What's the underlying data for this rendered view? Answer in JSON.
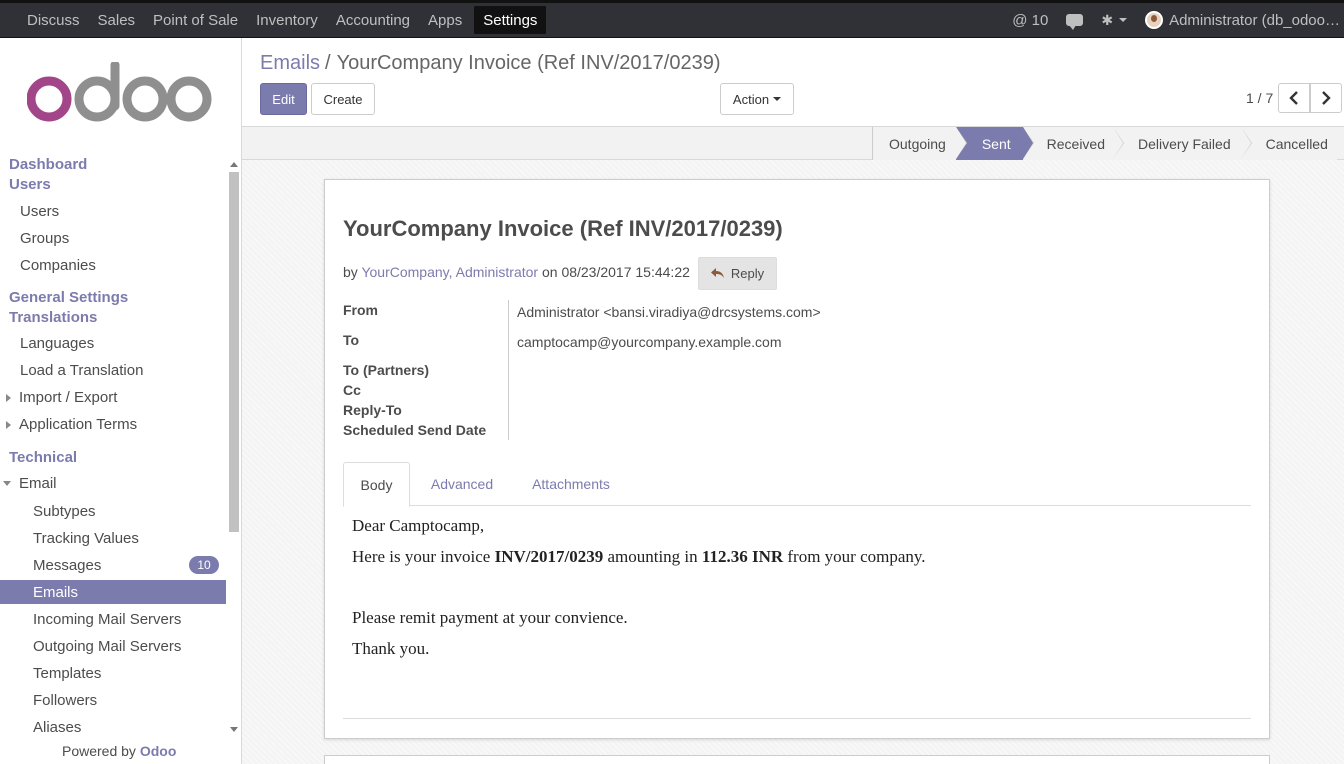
{
  "topbar": {
    "menu": [
      "Discuss",
      "Sales",
      "Point of Sale",
      "Inventory",
      "Accounting",
      "Apps",
      "Settings"
    ],
    "active": "Settings",
    "messages_count": "@ 10",
    "user": "Administrator (db_odoo…"
  },
  "sidebar": {
    "logo_text": "odoo",
    "items": [
      {
        "label": "Dashboard"
      },
      {
        "label": "Users"
      },
      {
        "label": "Users"
      },
      {
        "label": "Groups"
      },
      {
        "label": "Companies"
      },
      {
        "label": "General Settings"
      },
      {
        "label": "Translations"
      },
      {
        "label": "Languages"
      },
      {
        "label": "Load a Translation"
      },
      {
        "label": "Import / Export"
      },
      {
        "label": "Application Terms"
      },
      {
        "label": "Technical"
      },
      {
        "label": "Email"
      },
      {
        "label": "Subtypes"
      },
      {
        "label": "Tracking Values"
      },
      {
        "label": "Messages",
        "badge": "10"
      },
      {
        "label": "Emails"
      },
      {
        "label": "Incoming Mail Servers"
      },
      {
        "label": "Outgoing Mail Servers"
      },
      {
        "label": "Templates"
      },
      {
        "label": "Followers"
      },
      {
        "label": "Aliases"
      }
    ],
    "powered_prefix": "Powered by",
    "powered_brand": "Odoo"
  },
  "control": {
    "breadcrumb_parent": "Emails",
    "breadcrumb_sep": "/",
    "breadcrumb_current": "YourCompany Invoice (Ref INV/2017/0239)",
    "edit_label": "Edit",
    "create_label": "Create",
    "action_label": "Action",
    "pager": "1 / 7"
  },
  "statusbar": {
    "states": [
      "Outgoing",
      "Sent",
      "Received",
      "Delivery Failed",
      "Cancelled"
    ],
    "current": "Sent"
  },
  "email": {
    "subject": "YourCompany Invoice (Ref INV/2017/0239)",
    "by_prefix": "by",
    "authors": "YourCompany, Administrator",
    "on_prefix": "on",
    "date": "08/23/2017 15:44:22",
    "reply_label": "Reply",
    "fields": [
      {
        "label": "From",
        "value": "Administrator <bansi.viradiya@drcsystems.com>"
      },
      {
        "label": "To",
        "value": "camptocamp@yourcompany.example.com"
      },
      {
        "label": "To (Partners)",
        "value": ""
      },
      {
        "label": "Cc",
        "value": ""
      },
      {
        "label": "Reply-To",
        "value": ""
      },
      {
        "label": "Scheduled Send Date",
        "value": ""
      }
    ],
    "tabs": [
      "Body",
      "Advanced",
      "Attachments"
    ],
    "active_tab": "Body",
    "body": {
      "greeting": "Dear Camptocamp,",
      "line1_a": "Here is your invoice ",
      "line1_b": "INV/2017/0239",
      "line1_c": " amounting in ",
      "line1_d": "112.36 INR",
      "line1_e": " from your company.",
      "line2": "Please remit payment at your convience.",
      "line3": "Thank you."
    }
  }
}
